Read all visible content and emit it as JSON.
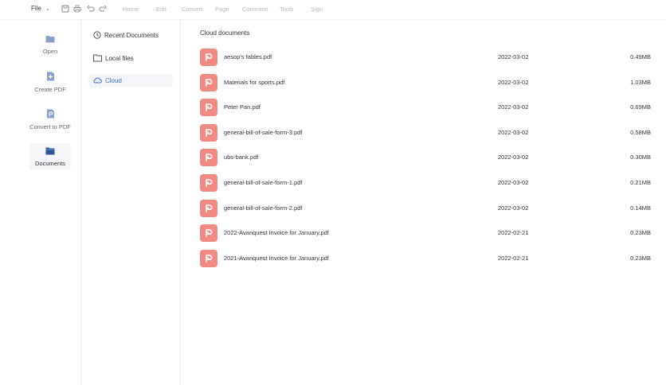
{
  "toolbar": {
    "file_label": "File",
    "menu": [
      "Home",
      "Edit",
      "Convert",
      "Page",
      "Comment",
      "Tools",
      "Sign"
    ]
  },
  "rail": [
    {
      "label": "Open",
      "icon": "folder-icon"
    },
    {
      "label": "Create PDF",
      "icon": "create-pdf-icon"
    },
    {
      "label": "Convert to PDF",
      "icon": "convert-pdf-icon"
    },
    {
      "label": "Documents",
      "icon": "documents-icon",
      "active": true
    }
  ],
  "subnav": [
    {
      "label": "Recent Documents",
      "icon": "clock-icon"
    },
    {
      "label": "Local files",
      "icon": "folder-outline-icon"
    },
    {
      "label": "Cloud",
      "icon": "cloud-icon",
      "active": true
    }
  ],
  "main": {
    "title": "Cloud documents",
    "files": [
      {
        "name": "aesop's fables.pdf",
        "date": "2022-03-02",
        "size": "0.49MB"
      },
      {
        "name": "Materials for sports.pdf",
        "date": "2022-03-02",
        "size": "1.03MB"
      },
      {
        "name": "Peter Pan.pdf",
        "date": "2022-03-02",
        "size": "0.69MB"
      },
      {
        "name": "general-bill-of-sale-form-3.pdf",
        "date": "2022-03-02",
        "size": "0.58MB"
      },
      {
        "name": "ubs-bank.pdf",
        "date": "2022-03-02",
        "size": "0.30MB"
      },
      {
        "name": "general-bill-of-sale-form-1.pdf",
        "date": "2022-03-02",
        "size": "0.21MB"
      },
      {
        "name": "general-bill-of-sale-form-2.pdf",
        "date": "2022-03-02",
        "size": "0.14MB"
      },
      {
        "name": "2022-Avanquest Invoice for January.pdf",
        "date": "2022-02-21",
        "size": "0.23MB"
      },
      {
        "name": "2021-Avanquest Invoice for January.pdf",
        "date": "2022-02-21",
        "size": "0.23MB"
      }
    ]
  },
  "colors": {
    "pdf_badge": "#f08a82",
    "accent": "#3d6fcf",
    "rail_icon": "#8aa0c8",
    "active_icon": "#2f5597"
  }
}
